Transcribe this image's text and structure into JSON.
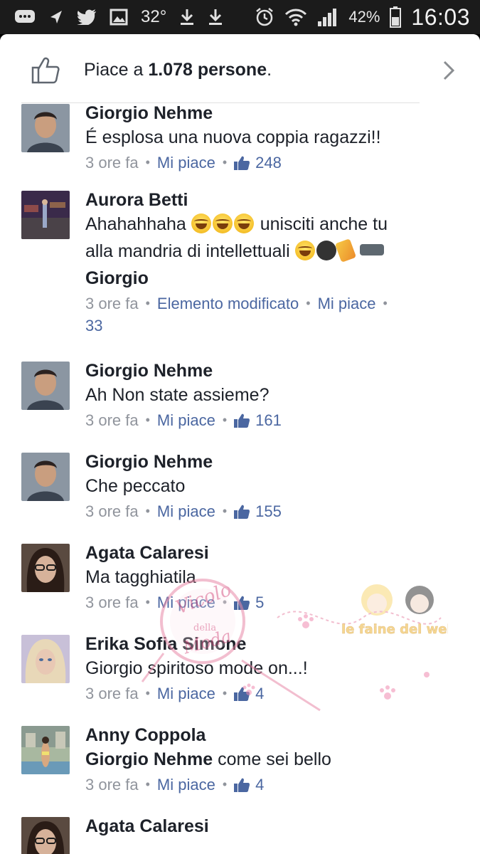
{
  "status_bar": {
    "temperature": "32°",
    "battery_percent": "42%",
    "time": "16:03",
    "icons": [
      "messages-icon",
      "navigation-icon",
      "twitter-icon",
      "gallery-icon",
      "download-icon",
      "download-icon",
      "alarm-icon",
      "wifi-icon",
      "signal-icon",
      "battery-icon"
    ]
  },
  "likes_header": {
    "prefix": "Piace a ",
    "count": "1.078 persone",
    "suffix": "."
  },
  "colors": {
    "fb_blue": "#4b67a1",
    "text": "#1d2129",
    "meta_gray": "#90949c"
  },
  "comments": [
    {
      "name": "Giorgio Nehme",
      "text": "É esplosa una nuova coppia ragazzi!!",
      "time": "3 ore fa",
      "like_label": "Mi piace",
      "likes": "248"
    },
    {
      "name": "Aurora Betti",
      "text_line1": "Ahahahhaha",
      "text_line1_after": " unisciti anche tu",
      "text_line2": "alla mandria di intellettuali ",
      "mention": "Giorgio",
      "time": "3 ore fa",
      "edited_label": "Elemento modificato",
      "like_label": "Mi piace",
      "likes": "33"
    },
    {
      "name": "Giorgio Nehme",
      "text": "Ah Non state assieme?",
      "time": "3 ore fa",
      "like_label": "Mi piace",
      "likes": "161"
    },
    {
      "name": "Giorgio Nehme",
      "text": "Che peccato",
      "time": "3 ore fa",
      "like_label": "Mi piace",
      "likes": "155"
    },
    {
      "name": "Agata Calaresi",
      "text": "Ma tagghiatila",
      "time": "3 ore fa",
      "like_label": "Mi piace",
      "likes": "5"
    },
    {
      "name": "Erika Sofia Simone",
      "text": "Giorgio spiritoso mode on...!",
      "time": "3 ore fa",
      "like_label": "Mi piace",
      "likes": "4"
    },
    {
      "name": "Anny Coppola",
      "mention": "Giorgio Nehme",
      "text": " come sei bello",
      "time": "3 ore fa",
      "like_label": "Mi piace",
      "likes": "4"
    },
    {
      "name": "Agata Calaresi"
    }
  ],
  "watermark": {
    "stamp_line1": "Vicolo",
    "stamp_line2": "della",
    "stamp_line3": "Moda",
    "banner": "le faine del web"
  }
}
